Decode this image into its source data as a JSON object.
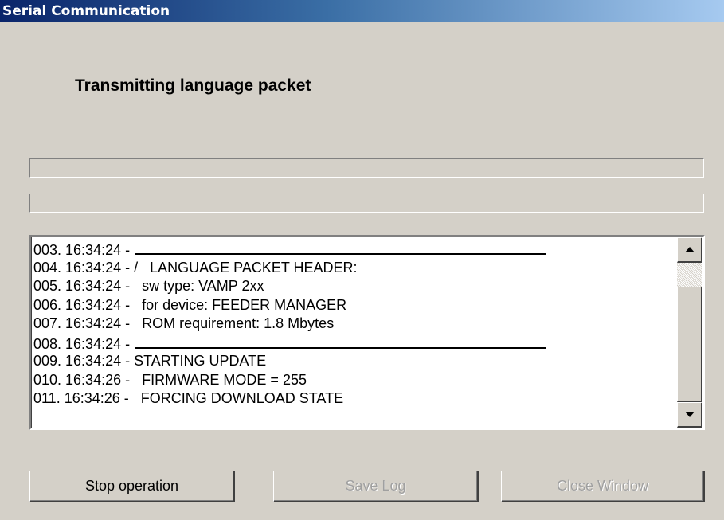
{
  "window": {
    "title": "Serial Communication"
  },
  "status": {
    "heading": "Transmitting language packet"
  },
  "progress": {
    "bar1": 0,
    "bar2": 0
  },
  "log": {
    "lines": [
      {
        "prefix": "003. 16:34:24 - ",
        "text": "",
        "rule": true
      },
      {
        "prefix": "004. 16:34:24 - ",
        "text": "/   LANGUAGE PACKET HEADER:",
        "rule": false
      },
      {
        "prefix": "005. 16:34:24 - ",
        "text": "  sw type: VAMP 2xx",
        "rule": false
      },
      {
        "prefix": "006. 16:34:24 - ",
        "text": "  for device: FEEDER MANAGER",
        "rule": false
      },
      {
        "prefix": "007. 16:34:24 - ",
        "text": "  ROM requirement: 1.8 Mbytes",
        "rule": false
      },
      {
        "prefix": "008. 16:34:24 - ",
        "text": "",
        "rule": true
      },
      {
        "prefix": "009. 16:34:24 - ",
        "text": "STARTING UPDATE",
        "rule": false
      },
      {
        "prefix": "010. 16:34:26 - ",
        "text": "  FIRMWARE MODE = 255",
        "rule": false
      },
      {
        "prefix": "011. 16:34:26 - ",
        "text": "  FORCING DOWNLOAD STATE",
        "rule": false
      }
    ]
  },
  "buttons": {
    "stop": "Stop operation",
    "save_log": "Save Log",
    "close_window": "Close Window"
  },
  "colors": {
    "titlebar_start": "#0a246a",
    "titlebar_end": "#a6caf0",
    "face": "#d4d0c8",
    "disabled_text": "#a0a0a0"
  }
}
